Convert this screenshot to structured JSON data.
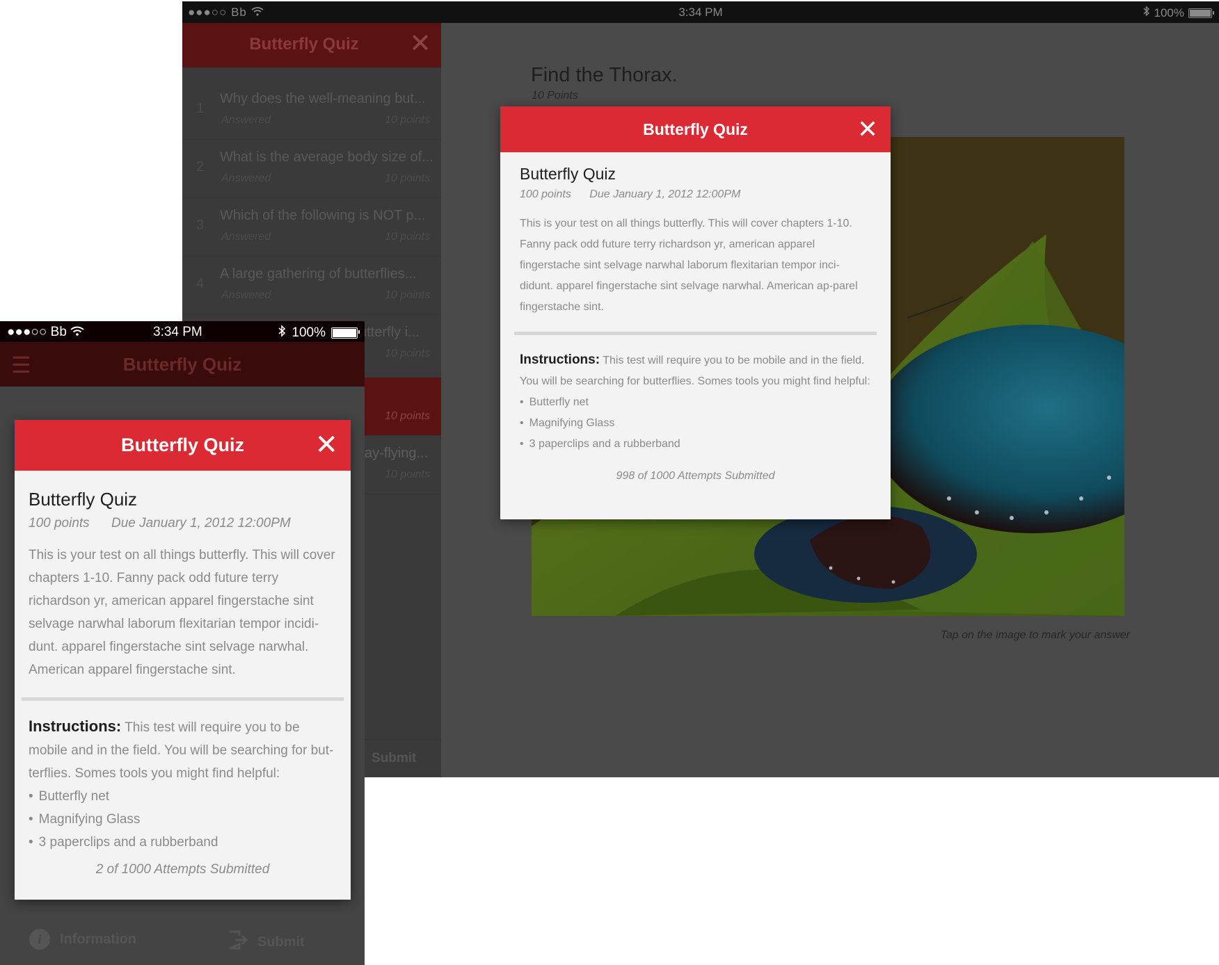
{
  "tablet": {
    "status": {
      "carrier": "●●●○○ Bb",
      "time": "3:34 PM",
      "battery": "100%"
    },
    "sidebar": {
      "title": "Butterfly Quiz",
      "questions": [
        {
          "num": "1",
          "text": "Why does the well-meaning but...",
          "status": "Answered",
          "points": "10 points"
        },
        {
          "num": "2",
          "text": "What is the average body size of...",
          "status": "Answered",
          "points": "10 points"
        },
        {
          "num": "3",
          "text": "Which of the following is NOT p...",
          "status": "Answered",
          "points": "10 points"
        },
        {
          "num": "4",
          "text": "A large gathering of butterflies...",
          "status": "Answered",
          "points": "10 points"
        },
        {
          "num": "",
          "text": "utterfly i...",
          "status": "",
          "points": "10 points"
        },
        {
          "num": "",
          "text": "",
          "status": "",
          "points": "10 points"
        },
        {
          "num": "",
          "text": "ay-flying...",
          "status": "",
          "points": "10 points"
        }
      ],
      "submit": "Submit"
    },
    "main": {
      "title": "Find the Thorax.",
      "points": "10 Points",
      "hint": "Tap on the image to mark your answer"
    },
    "modal": {
      "header": "Butterfly Quiz",
      "title": "Butterfly Quiz",
      "points": "100 points",
      "due": "Due  January 1, 2012 12:00PM",
      "description": "This is your test on all things butterfly. This will cover chapters 1-10. Fanny pack odd future terry richardson yr, american apparel fingerstache sint selvage narwhal laborum flexitarian tempor inci-didunt. apparel fingerstache sint selvage narwhal. American ap-parel fingerstache sint.",
      "instructions_label": "Instructions:",
      "instructions": "This test will require you to be mobile and in the field. You will be searching for butterflies. Somes tools you might find helpful:",
      "tools": [
        "Butterfly net",
        "Magnifying Glass",
        "3 paperclips and a rubberband"
      ],
      "attempts": "998 of 1000 Attempts Submitted"
    }
  },
  "phone": {
    "status": {
      "carrier": "●●●○○ Bb",
      "time": "3:34 PM",
      "battery": "100%"
    },
    "nav_title": "Butterfly Quiz",
    "modal": {
      "header": "Butterfly Quiz",
      "title": "Butterfly Quiz",
      "points": "100 points",
      "due": "Due  January 1, 2012 12:00PM",
      "description": "This is your test on all things butterfly. This will cover chapters 1-10. Fanny pack odd future terry richardson yr, american apparel fingerstache sint selvage narwhal laborum flexitarian tempor incidi-dunt. apparel fingerstache sint selvage narwhal. American apparel fingerstache sint.",
      "instructions_label": "Instructions:",
      "instructions": "This test will require you to be mobile and in the field. You will be searching for but-terflies. Somes tools you might find helpful:",
      "tools": [
        "Butterfly net",
        "Magnifying Glass",
        "3 paperclips and a rubberband"
      ],
      "attempts": "2 of 1000 Attempts Submitted"
    },
    "tabbar": {
      "info": "Information",
      "submit": "Submit"
    }
  },
  "colors": {
    "accent": "#dc2a35",
    "overlay": "#4a4a4a",
    "modal_bg": "#f3f3f3"
  },
  "icons": [
    "close-icon",
    "menu-icon",
    "wifi-icon",
    "bluetooth-icon",
    "battery-icon",
    "info-icon",
    "submit-icon"
  ]
}
